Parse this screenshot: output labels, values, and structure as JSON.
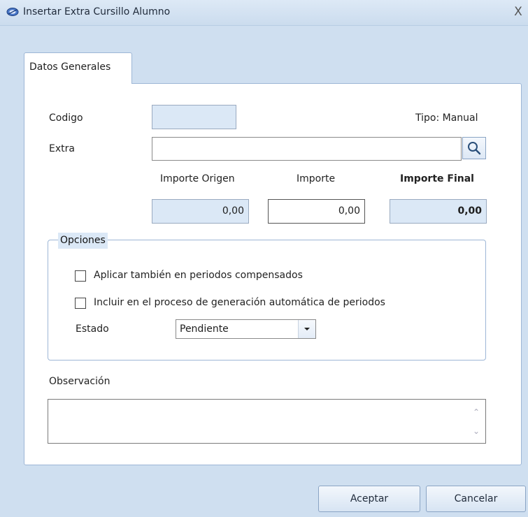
{
  "window": {
    "title": "Insertar Extra Cursillo Alumno",
    "close_symbol": "X",
    "app_icon": "app-logo-icon"
  },
  "tabs": [
    {
      "label": "Datos Generales",
      "active": true
    }
  ],
  "form": {
    "codigo_label": "Codigo",
    "codigo_value": "",
    "tipo_text": "Tipo: Manual",
    "extra_label": "Extra",
    "extra_value": "",
    "search_icon": "search-icon",
    "importe_origen_label": "Importe Origen",
    "importe_label": "Importe",
    "importe_final_label": "Importe Final",
    "importe_origen_value": "0,00",
    "importe_value": "0,00",
    "importe_final_value": "0,00"
  },
  "opciones": {
    "legend": "Opciones",
    "check1_label": "Aplicar también en periodos compensados",
    "check1_checked": false,
    "check2_label": "Incluir en el proceso de generación automática de periodos",
    "check2_checked": false,
    "estado_label": "Estado",
    "estado_value": "Pendiente"
  },
  "observacion": {
    "label": "Observación",
    "value": ""
  },
  "buttons": {
    "accept": "Aceptar",
    "cancel": "Cancelar"
  },
  "colors": {
    "window_bg": "#cfdff0",
    "readonly_field": "#dbe8f6",
    "border_accent": "#9db6d6"
  }
}
